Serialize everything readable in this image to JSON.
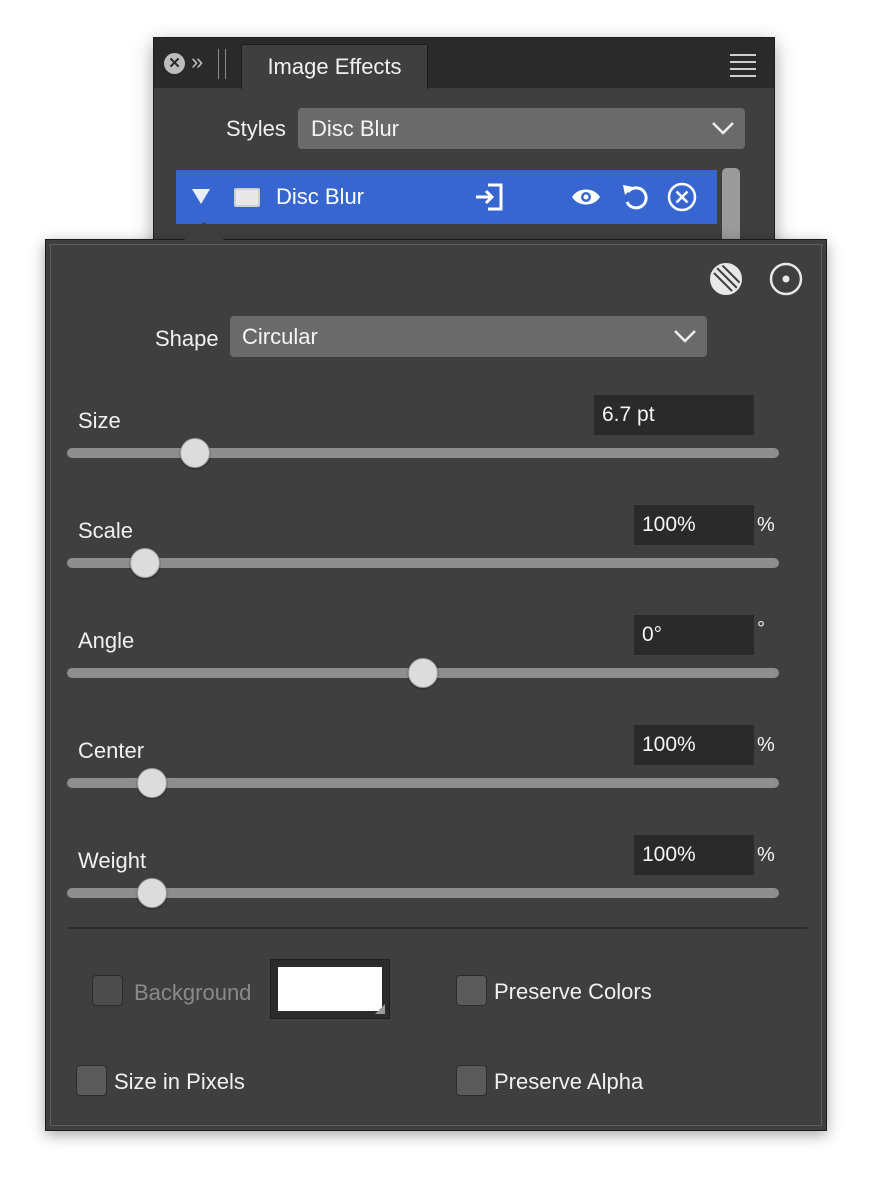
{
  "panel": {
    "tab_label": "Image Effects",
    "styles_label": "Styles",
    "styles_value": "Disc Blur",
    "effect_name": "Disc Blur",
    "accent": "#3766d1"
  },
  "shape": {
    "label": "Shape",
    "value": "Circular"
  },
  "controls": [
    {
      "label": "Size",
      "value": "6.7 pt",
      "unit": "",
      "slider": 0.18
    },
    {
      "label": "Scale",
      "value": "100%",
      "unit": "%",
      "slider": 0.11
    },
    {
      "label": "Angle",
      "value": "0°",
      "unit": "°",
      "slider": 0.5
    },
    {
      "label": "Center",
      "value": "100%",
      "unit": "%",
      "slider": 0.12
    },
    {
      "label": "Weight",
      "value": "100%",
      "unit": "%",
      "slider": 0.12
    }
  ],
  "options": {
    "background_label": "Background",
    "background_color": "#ffffff",
    "size_in_pixels_label": "Size in Pixels",
    "preserve_colors_label": "Preserve Colors",
    "preserve_alpha_label": "Preserve Alpha"
  },
  "icons": [
    "close-icon",
    "expand-icon",
    "menu-icon",
    "chevron-down-icon",
    "disclosure-triangle-icon",
    "effect-thumbnail-icon",
    "import-icon",
    "eye-icon",
    "reset-icon",
    "remove-icon",
    "hatched-circle-icon",
    "target-icon"
  ]
}
